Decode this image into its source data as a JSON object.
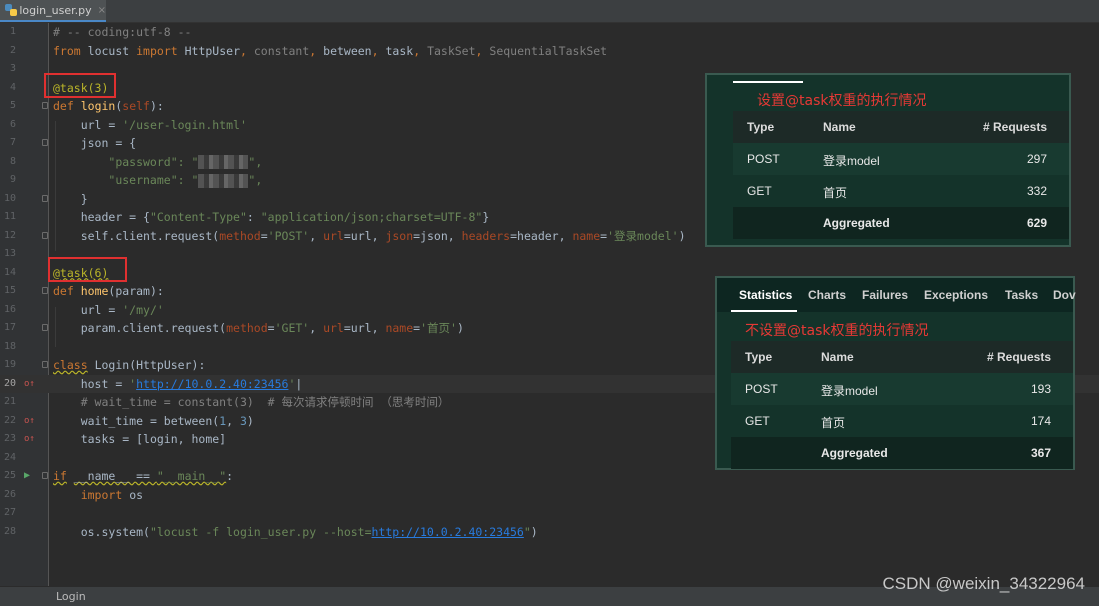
{
  "tab": {
    "filename": "login_user.py",
    "close": "×"
  },
  "lines": {
    "l1": "# -- coding:utf-8 --",
    "l2_kw1": "from",
    "l2_mod": "locust",
    "l2_kw2": "import",
    "l2_i1": "HttpUser",
    "l2_i2": "constant",
    "l2_i3": "between",
    "l2_i4": "task",
    "l2_i5": "TaskSet",
    "l2_i6": "SequentialTaskSet",
    "l4": "@task(3)",
    "l5_def": "def",
    "l5_fn": "login",
    "l5_self": "self",
    "l6_url": "url = ",
    "l6_val": "'/user-login.html'",
    "l7": "json = {",
    "l8_key": "\"password\": ",
    "l8_q": "\"",
    "l8_end": "\",",
    "l9_key": "\"username\": ",
    "l9_q": "\"",
    "l9_end": "\",",
    "l10": "}",
    "l11_a": "header = {",
    "l11_k": "\"Content-Type\"",
    "l11_v": "\"application/json;charset=UTF-8\"",
    "l11_e": "}",
    "l12_a": "self.client.request(",
    "l12_p1": "method",
    "l12_v1": "'POST'",
    "l12_p2": "url",
    "l12_v2": "url",
    "l12_p3": "json",
    "l12_v3": "json",
    "l12_p4": "headers",
    "l12_v4": "header",
    "l12_p5": "name",
    "l12_v5": "'登录model'",
    "l14": "@task(6)",
    "l15_def": "def",
    "l15_fn": "home",
    "l15_param": "param",
    "l16_url": "url = ",
    "l16_val": "'/my/'",
    "l17_a": "param.client.request(",
    "l17_p1": "method",
    "l17_v1": "'GET'",
    "l17_p2": "url",
    "l17_v2": "url",
    "l17_p3": "name",
    "l17_v3": "'首页'",
    "l19_kw": "class",
    "l19_name": "Login",
    "l19_base": "HttpUser",
    "l20_a": "host = ",
    "l20_link": "http://10.0.2.40:23456",
    "l21": "# wait_time = constant(3)  # 每次请求停顿时间 （思考时间）",
    "l22_a": "wait_time = between(",
    "l22_n1": "1",
    "l22_n2": "3",
    "l23": "tasks = [login, home]",
    "l25_kw": "if",
    "l25_a": "__name__ == ",
    "l25_v": "\"__main__\"",
    "l25_c": ":",
    "l26_kw": "import",
    "l26_m": "os",
    "l28_a": "os.system(",
    "l28_s1": "\"locust -f login_user.py --host=",
    "l28_link": "http://10.0.2.40:23456",
    "l28_s2": "\"",
    "l28_end": ")"
  },
  "line_numbers": [
    "1",
    "2",
    "3",
    "4",
    "5",
    "6",
    "7",
    "8",
    "9",
    "10",
    "11",
    "12",
    "13",
    "14",
    "15",
    "16",
    "17",
    "18",
    "19",
    "20",
    "21",
    "22",
    "23",
    "24",
    "25",
    "26",
    "27",
    "28"
  ],
  "panel1": {
    "title": "设置@task权重的执行情况",
    "headers": [
      "Type",
      "Name",
      "# Requests"
    ],
    "rows": [
      {
        "type": "POST",
        "name": "登录model",
        "requests": "297"
      },
      {
        "type": "GET",
        "name": "首页",
        "requests": "332"
      }
    ],
    "aggregate": {
      "name": "Aggregated",
      "requests": "629"
    }
  },
  "panel2": {
    "tabs": [
      "Statistics",
      "Charts",
      "Failures",
      "Exceptions",
      "Tasks",
      "Dov"
    ],
    "title": "不设置@task权重的执行情况",
    "headers": [
      "Type",
      "Name",
      "# Requests"
    ],
    "rows": [
      {
        "type": "POST",
        "name": "登录model",
        "requests": "193"
      },
      {
        "type": "GET",
        "name": "首页",
        "requests": "174"
      }
    ],
    "aggregate": {
      "name": "Aggregated",
      "requests": "367"
    }
  },
  "status": {
    "breadcrumb": "Login"
  },
  "watermark": "CSDN @weixin_34322964"
}
